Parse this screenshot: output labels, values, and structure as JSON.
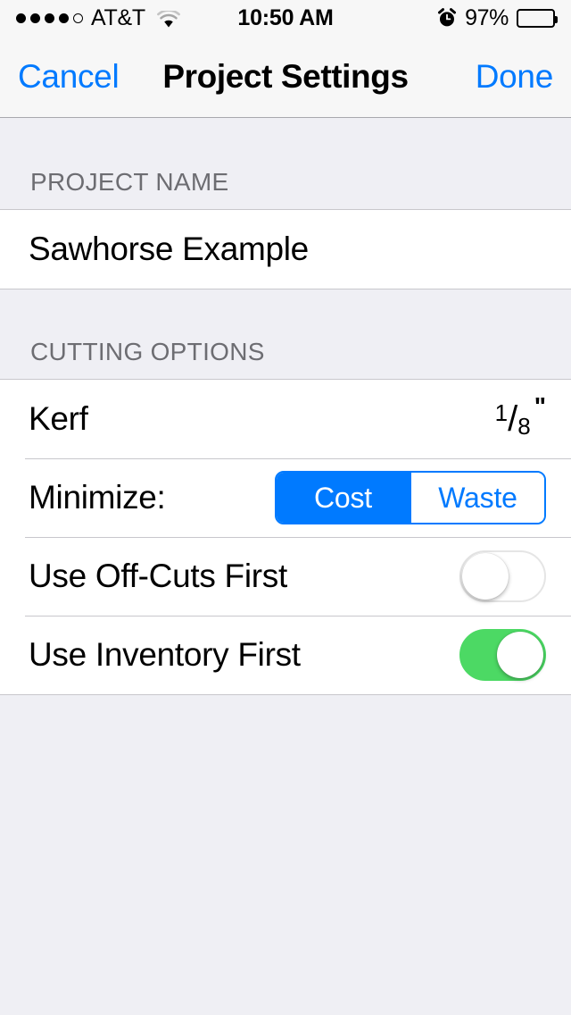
{
  "status_bar": {
    "carrier": "AT&T",
    "signal_dots_filled": 4,
    "signal_dots_total": 5,
    "wifi_icon": "wifi-icon",
    "time": "10:50 AM",
    "alarm_icon": "alarm-clock-icon",
    "battery_percent": "97%",
    "battery_icon": "battery-icon",
    "battery_level": 97
  },
  "nav_bar": {
    "cancel_label": "Cancel",
    "title": "Project Settings",
    "done_label": "Done",
    "tint_color": "#007AFF"
  },
  "sections": [
    {
      "header": "PROJECT NAME",
      "rows": [
        {
          "type": "text",
          "label": "Sawhorse Example"
        }
      ]
    },
    {
      "header": "CUTTING OPTIONS",
      "rows": [
        {
          "type": "fraction",
          "label": "Kerf",
          "value": "1/8\"",
          "numerator": "1",
          "denominator": "8",
          "unit": "\""
        },
        {
          "type": "segmented",
          "label": "Minimize:",
          "options": [
            "Cost",
            "Waste"
          ],
          "selected": "Cost"
        },
        {
          "type": "toggle",
          "label": "Use Off-Cuts First",
          "value": "off"
        },
        {
          "type": "toggle",
          "label": "Use Inventory First",
          "value": "on"
        }
      ]
    }
  ],
  "colors": {
    "accent_blue": "#007AFF",
    "toggle_on_green": "#4CD964",
    "group_background": "#FFFFFF",
    "page_background": "#EFEFF4",
    "header_text": "#6D6D72",
    "separator": "#C8C7CC"
  }
}
